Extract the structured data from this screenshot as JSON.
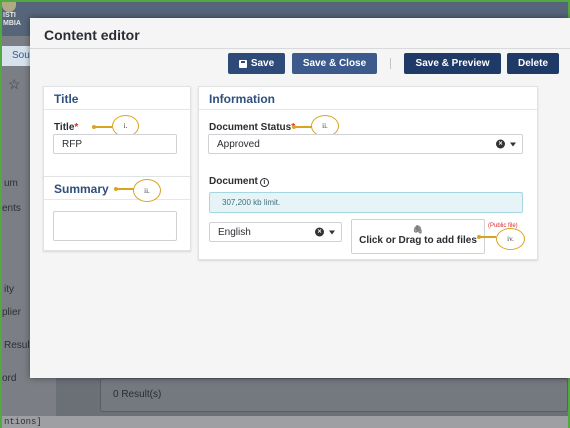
{
  "background": {
    "logo_lines": [
      "ISTI",
      "MBIA"
    ],
    "tab_label": "Sou",
    "menu_items": [
      "um",
      "ents",
      "ity",
      "plier",
      "Results",
      "ord"
    ],
    "results_text": "0 Result(s)",
    "status_text": "ntions]"
  },
  "modal": {
    "title": "Content editor",
    "buttons": {
      "save": "Save",
      "save_close": "Save & Close",
      "save_preview": "Save & Preview",
      "delete": "Delete"
    },
    "title_panel": {
      "heading": "Title",
      "field_label": "Title",
      "required_mark": "*",
      "value": "RFP",
      "marker": "i."
    },
    "summary_panel": {
      "heading": "Summary",
      "value": "",
      "marker": "ii."
    },
    "information_panel": {
      "heading": "Information",
      "status_label": "Document Status",
      "required_mark": "*",
      "status_value": "Approved",
      "status_marker": "ii.",
      "document_label": "Document",
      "limit_text": "307,200 kb limit.",
      "language_value": "English",
      "dropzone_text": "Click or Drag to add files",
      "public_tag": "(Public file)",
      "dropzone_marker": "iv."
    }
  },
  "colors": {
    "primary_button": "#2e4a78",
    "panel_heading": "#2f4f7e",
    "required": "#d9292b",
    "marker": "#d9a521",
    "frame_border": "#53a842"
  }
}
